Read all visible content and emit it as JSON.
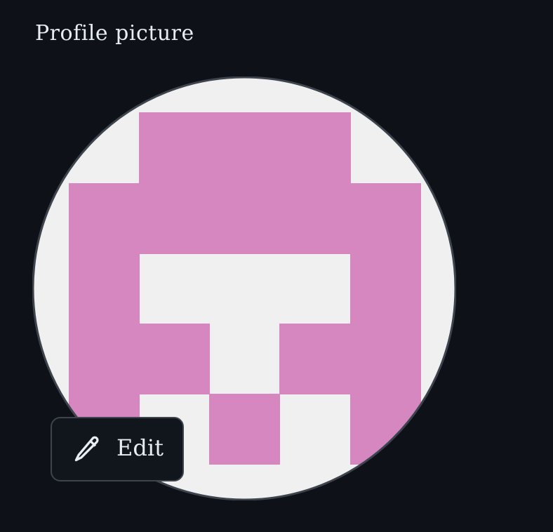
{
  "header": {
    "title": "Profile picture"
  },
  "avatar": {
    "background_color": "#f0f0f0",
    "pattern_color": "#d687bf",
    "border_color": "#3d444d"
  },
  "edit_button": {
    "label": "Edit",
    "icon": "pencil-icon"
  },
  "colors": {
    "page_background": "#0e1117",
    "text": "#e6edf3"
  }
}
